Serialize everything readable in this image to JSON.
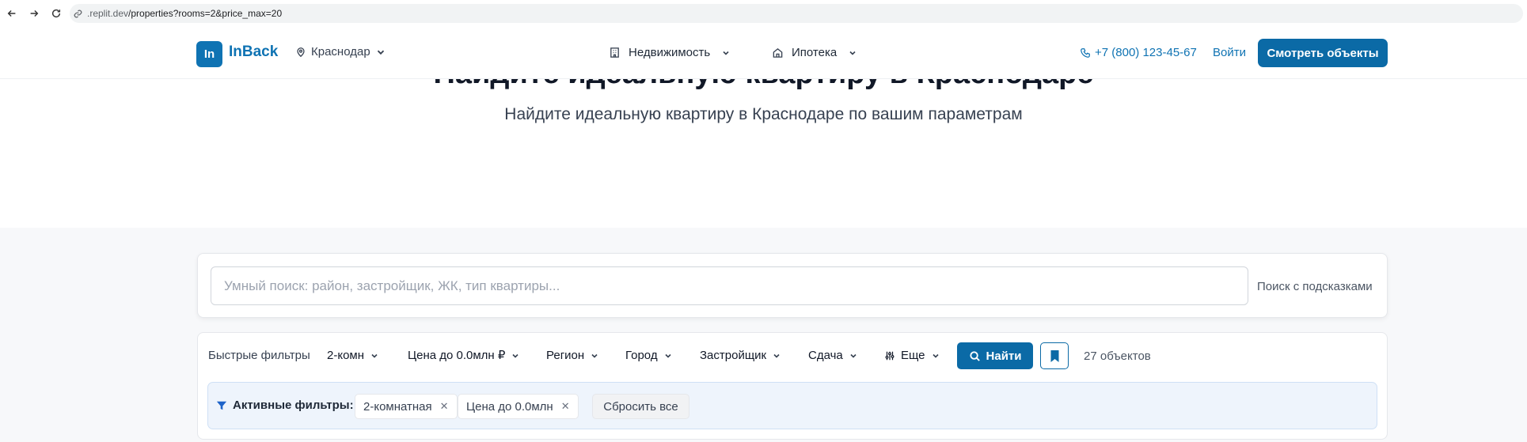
{
  "browser": {
    "url_host": ".replit.dev",
    "url_path": "/properties?rooms=2&price_max=20"
  },
  "header": {
    "logo_mark": "In",
    "logo_text": "InBack",
    "city": "Краснодар",
    "menu": [
      {
        "label": "Недвижимость",
        "icon": "building-icon"
      },
      {
        "label": "Ипотека",
        "icon": "home-icon"
      }
    ],
    "phone": "+7 (800) 123-45-67",
    "login": "Войти",
    "cta": "Смотреть объекты"
  },
  "hero": {
    "title": "Найдите идеальную квартиру в Краснодаре",
    "subtitle": "Найдите идеальную квартиру в Краснодаре по вашим параметрам"
  },
  "search": {
    "placeholder": "Умный поиск: район, застройщик, ЖК, тип квартиры...",
    "value": "",
    "hint": "Поиск с подсказками"
  },
  "filters": {
    "quick_label": "Быстрые фильтры",
    "dropdowns": [
      "2-комн",
      "Цена до 0.0млн ₽",
      "Регион",
      "Город",
      "Застройщик",
      "Сдача",
      "Еще"
    ],
    "find_label": "Найти",
    "count": "27 объектов",
    "active_label": "Активные фильтры:",
    "chips": [
      "2-комнатная",
      "Цена до 0.0млн"
    ],
    "reset_label": "Сбросить все"
  },
  "colors": {
    "brand": "#0f73b3",
    "button": "#0b6aa6",
    "active_bg": "#eef4fc"
  }
}
